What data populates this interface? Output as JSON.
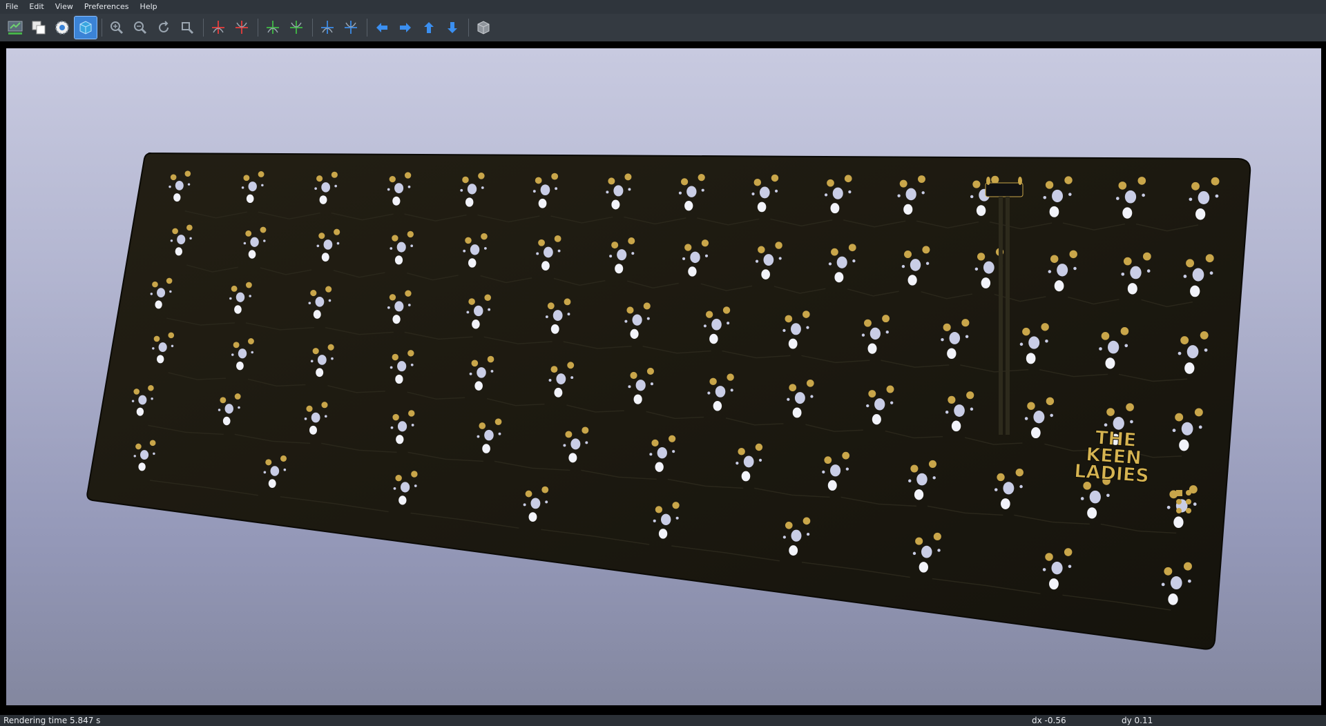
{
  "menu": [
    "File",
    "Edit",
    "View",
    "Preferences",
    "Help"
  ],
  "toolbar": {
    "buttons": [
      {
        "name": "reload-board-icon"
      },
      {
        "name": "copy-image-icon"
      },
      {
        "name": "settings-gear-icon"
      },
      {
        "name": "raytracing-cube-icon",
        "active": true
      },
      {
        "name": "zoom-in-icon"
      },
      {
        "name": "zoom-out-icon"
      },
      {
        "name": "redraw-icon"
      },
      {
        "name": "zoom-fit-icon"
      },
      {
        "name": "rotate-x-cw-icon"
      },
      {
        "name": "rotate-x-ccw-icon"
      },
      {
        "name": "rotate-y-cw-icon"
      },
      {
        "name": "rotate-y-ccw-icon"
      },
      {
        "name": "rotate-z-cw-icon"
      },
      {
        "name": "rotate-z-ccw-icon"
      },
      {
        "name": "move-left-icon"
      },
      {
        "name": "move-right-icon"
      },
      {
        "name": "move-up-icon"
      },
      {
        "name": "move-down-icon"
      },
      {
        "name": "ortho-view-icon"
      }
    ]
  },
  "board": {
    "logo_lines": [
      "THE",
      "KEEN",
      "LADIES"
    ]
  },
  "status": {
    "render_time": "Rendering time 5.847 s",
    "dx": "dx -0.56",
    "dy": "dy 0.11"
  },
  "colors": {
    "pcb": "#1a1810",
    "pad_gold": "#c9a64a",
    "hole": "#c9cde6",
    "accent": "#3b83d6"
  }
}
